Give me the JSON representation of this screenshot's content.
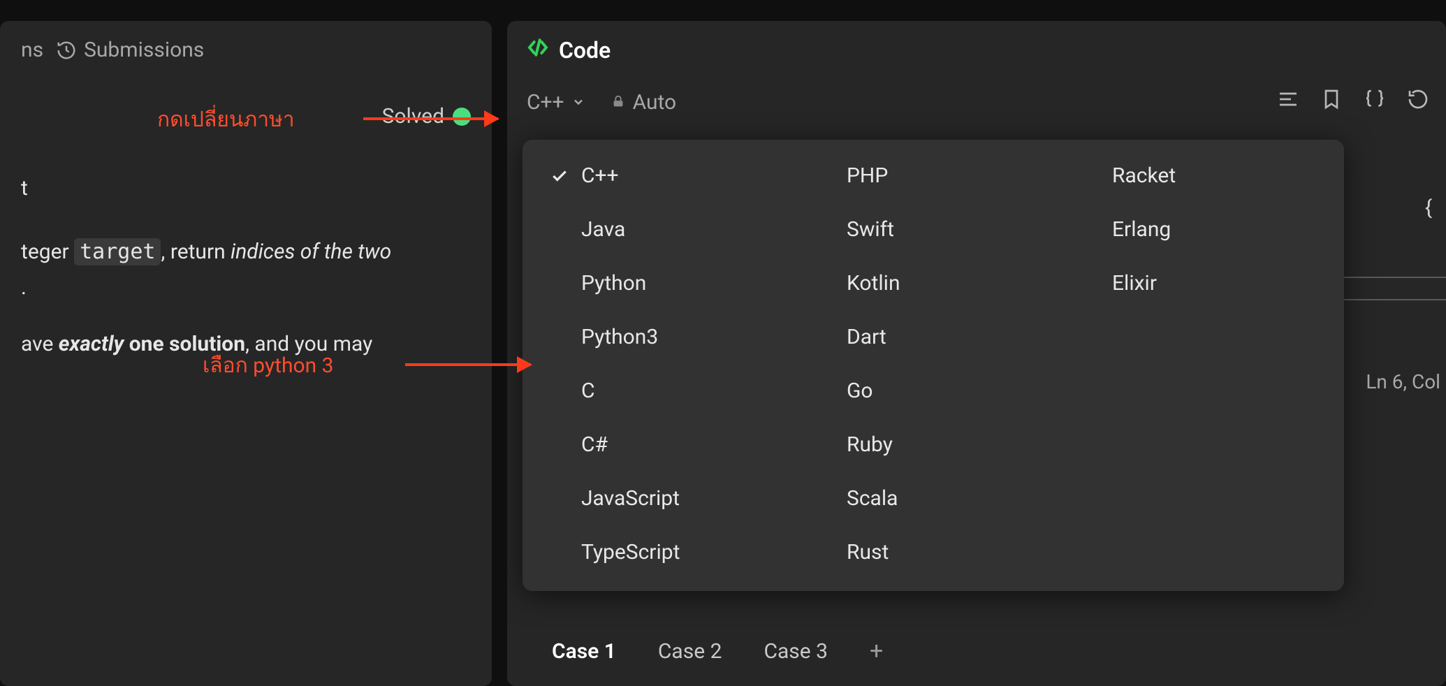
{
  "left": {
    "tabs": {
      "description_partial": "ns",
      "submissions": "Submissions"
    },
    "solved_label": "Solved",
    "desc": {
      "line1_prefix": "t",
      "line2_pre": "teger ",
      "line2_code": "target",
      "line2_mid": ", return ",
      "line2_em": "indices of the two",
      "line3": ".",
      "line4_pre": "ave ",
      "line4_strong": "exactly",
      "line4_mid": " one solution",
      "line4_post": ", and you may"
    }
  },
  "right": {
    "code_title": "Code",
    "language_selected": "C++",
    "auto_label": "Auto",
    "status_line": "Ln 6, Col",
    "brace": "{",
    "cases": [
      "Case 1",
      "Case 2",
      "Case 3"
    ]
  },
  "dropdown": {
    "col1": [
      "C++",
      "Java",
      "Python",
      "Python3",
      "C",
      "C#",
      "JavaScript",
      "TypeScript"
    ],
    "col2": [
      "PHP",
      "Swift",
      "Kotlin",
      "Dart",
      "Go",
      "Ruby",
      "Scala",
      "Rust"
    ],
    "col3": [
      "Racket",
      "Erlang",
      "Elixir"
    ]
  },
  "annotations": {
    "a1": "กดเปลี่ยนภาษา",
    "a2": "เลือก python 3"
  }
}
